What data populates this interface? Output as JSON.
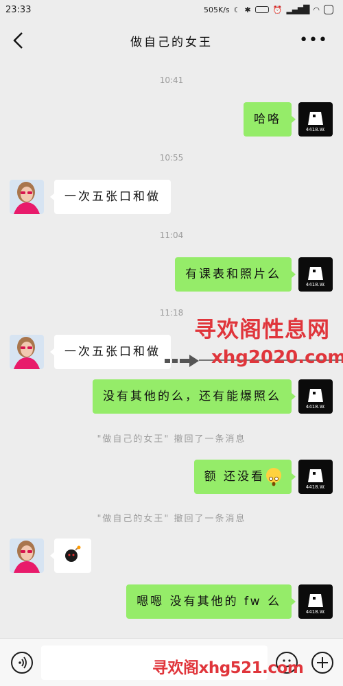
{
  "status_bar": {
    "time": "23:33",
    "network_speed": "505K/s",
    "battery_icon": "battery-icon",
    "alarm_icon": "alarm-icon"
  },
  "header": {
    "title": "做自己的女王",
    "back_icon": "chevron-left-icon",
    "more_icon": "more-dots-icon"
  },
  "messages": [
    {
      "type": "time",
      "text": "10:41"
    },
    {
      "type": "out",
      "text": "哈咯"
    },
    {
      "type": "time",
      "text": "10:55"
    },
    {
      "type": "in",
      "text": "一次五张口和做"
    },
    {
      "type": "time",
      "text": "11:04"
    },
    {
      "type": "out",
      "text": "有课表和照片么"
    },
    {
      "type": "time",
      "text": "11:18"
    },
    {
      "type": "in",
      "text": "一次五张口和做"
    },
    {
      "type": "out",
      "text": "没有其他的么，还有能爆照么"
    },
    {
      "type": "recall",
      "text": "\"做自己的女王\" 撤回了一条消息"
    },
    {
      "type": "out",
      "text": "额 还没看",
      "emoji": "astonished-emoji"
    },
    {
      "type": "recall",
      "text": "\"做自己的女王\" 撤回了一条消息"
    },
    {
      "type": "in",
      "text": "",
      "emoji": "bomb-emoji"
    },
    {
      "type": "out",
      "text": "嗯嗯  没有其他的 fw 么"
    }
  ],
  "watermark": {
    "line1": "寻欢阁性息网",
    "line2": "xhg2020.com",
    "bottom": "寻欢阁xhg521.com",
    "color": "#e0353b"
  },
  "input_bar": {
    "placeholder": "",
    "voice_icon": "voice-icon",
    "emoji_icon": "emoji-icon",
    "plus_icon": "plus-icon"
  },
  "colors": {
    "outgoing_bubble": "#95ec69",
    "incoming_bubble": "#ffffff",
    "background": "#ededed"
  }
}
